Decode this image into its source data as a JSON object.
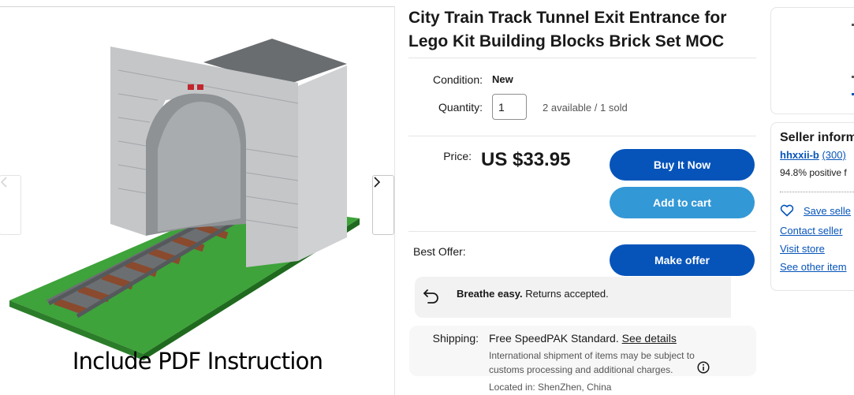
{
  "product": {
    "title": "City Train Track Tunnel Exit Entrance for Lego Kit Building Blocks Brick Set MOC",
    "image_caption": "Include PDF Instruction"
  },
  "condition": {
    "label": "Condition:",
    "value": "New"
  },
  "quantity": {
    "label": "Quantity:",
    "value": "1",
    "availability": "2 available / 1 sold"
  },
  "price": {
    "label": "Price:",
    "value": "US $33.95"
  },
  "buttons": {
    "buy_now": "Buy It Now",
    "add_to_cart": "Add to cart",
    "make_offer": "Make offer"
  },
  "best_offer": {
    "label": "Best Offer:"
  },
  "returns": {
    "bold": "Breathe easy.",
    "text": "Returns accepted."
  },
  "shipping": {
    "label": "Shipping:",
    "method": "Free SpeedPAK Standard.",
    "details_link": "See details",
    "note_line1": "International shipment of items may be subject to",
    "note_line2": "customs processing and additional charges.",
    "location": "Located in: ShenZhen, China"
  },
  "seller": {
    "heading": "Seller inform",
    "name": "hhxxii-b",
    "feedback": "(300)",
    "positive": "94.8% positive f",
    "save": "Save selle",
    "contact": "Contact seller",
    "store": "Visit store",
    "other": "See other item"
  },
  "colors": {
    "primary_blue": "#0654ba",
    "light_blue": "#3398d6",
    "link_blue": "#0654ba"
  },
  "icons": [
    "chevron-left-icon",
    "chevron-right-icon",
    "return-arrow-icon",
    "info-icon",
    "heart-icon"
  ]
}
